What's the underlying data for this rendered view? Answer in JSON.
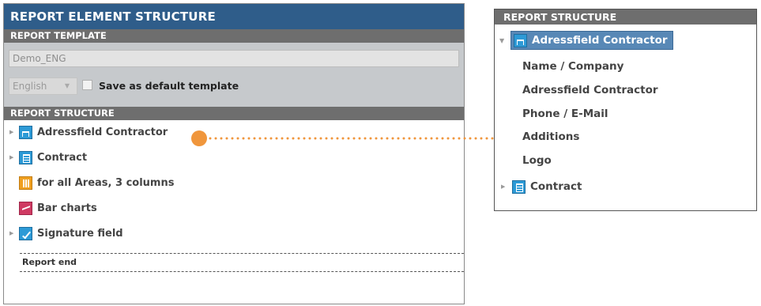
{
  "left_panel": {
    "title": "REPORT ELEMENT STRUCTURE",
    "template_header": "REPORT TEMPLATE",
    "template_value": "Demo_ENG",
    "language": "English",
    "default_checkbox_label": "Save as default template",
    "structure_header": "REPORT STRUCTURE",
    "tree": [
      {
        "label": "Adressfield Contractor",
        "icon": "address-block-icon",
        "expandable": true
      },
      {
        "label": "Contract",
        "icon": "contract-doc-icon",
        "expandable": true
      },
      {
        "label": "for all Areas, 3 columns",
        "icon": "columns-icon",
        "expandable": false
      },
      {
        "label": "Bar charts",
        "icon": "bar-chart-icon",
        "expandable": false
      },
      {
        "label": "Signature field",
        "icon": "signature-icon",
        "expandable": true
      }
    ],
    "report_end": "Report end"
  },
  "right_panel": {
    "header": "REPORT STRUCTURE",
    "expanded_item": {
      "label": "Adressfield Contractor",
      "icon": "address-block-icon"
    },
    "children": [
      "Name / Company",
      "Adressfield Contractor",
      "Phone / E-Mail",
      "Additions",
      "Logo"
    ],
    "collapsed_item": {
      "label": "Contract",
      "icon": "contract-doc-icon"
    }
  },
  "colors": {
    "title_bar": "#2f5d8a",
    "section_bar": "#6e6e6e",
    "connector": "#f0963c",
    "selected": "#5888b6"
  }
}
